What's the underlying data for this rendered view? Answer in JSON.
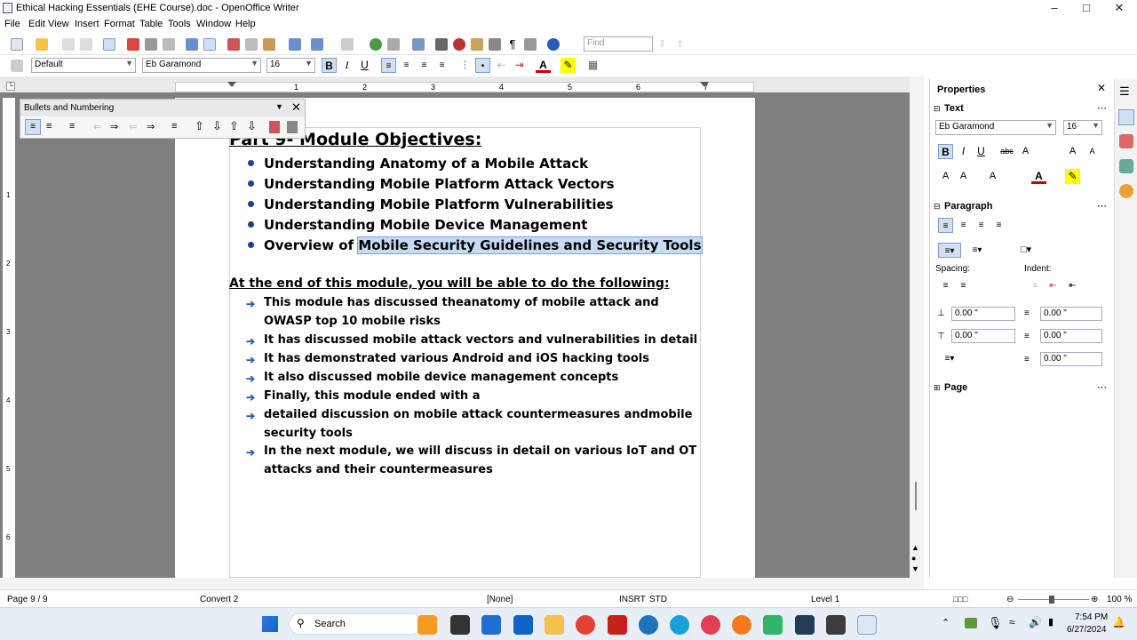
{
  "window": {
    "title": "Ethical Hacking Essentials (EHE Course).doc - OpenOffice Writer"
  },
  "menu": [
    "File",
    "Edit",
    "View",
    "Insert",
    "Format",
    "Table",
    "Tools",
    "Window",
    "Help"
  ],
  "toolbar": {
    "find_placeholder": "Find"
  },
  "format": {
    "style": "Default",
    "font": "Eb Garamond",
    "size": "16"
  },
  "bullets_panel": {
    "title": "Bullets and Numbering"
  },
  "document": {
    "heading1": {
      "prefix": "Part 9- ",
      "text": "Module Objectives:"
    },
    "objectives": [
      "Understanding Anatomy of a Mobile Attack",
      "Understanding Mobile Platform Attack Vectors",
      "Understanding Mobile Platform Vulnerabilities",
      "Understanding Mobile Device Management"
    ],
    "last_objective": {
      "plain": "Overview of ",
      "selected": "Mobile Security Guidelines and Security Tools"
    },
    "heading2": "At the end of this module, you will be able to do the following:",
    "summary": [
      {
        "l1": "This module has discussed theanatomy of mobile attack and",
        "l2": "OWASP top 10 mobile risks"
      },
      {
        "l1": "It has discussed mobile attack vectors and vulnerabilities in detail"
      },
      {
        "l1": "It has demonstrated various Android and iOS hacking tools"
      },
      {
        "l1": "It also discussed mobile device management concepts"
      },
      {
        "l1": "Finally, this module ended with a"
      },
      {
        "l1": "detailed discussion on mobile attack countermeasures andmobile",
        "l2": "security tools"
      },
      {
        "l1": "In the next module, we will discuss in detail on various IoT and OT",
        "l2": "attacks and their countermeasures"
      }
    ]
  },
  "sidebar": {
    "title": "Properties",
    "text_section": "Text",
    "font": "Eb Garamond",
    "size": "16",
    "paragraph_section": "Paragraph",
    "spacing_label": "Spacing:",
    "indent_label": "Indent:",
    "spin_values": [
      "0.00 \"",
      "0.00 \"",
      "0.00 \"",
      "0.00 \"",
      "0.00 \""
    ],
    "page_section": "Page"
  },
  "ruler_numbers": [
    "1",
    "2",
    "3",
    "4",
    "5",
    "6",
    "7"
  ],
  "vruler_numbers": [
    "1",
    "2",
    "3",
    "4",
    "5",
    "6"
  ],
  "status": {
    "page": "Page 9 / 9",
    "convert": "Convert 2",
    "none": "[None]",
    "insrt": "INSRT",
    "std": "STD",
    "level": "Level 1",
    "zoom": "100 %"
  },
  "taskbar": {
    "search": "Search",
    "time": "7:54 PM",
    "date": "6/27/2024"
  }
}
